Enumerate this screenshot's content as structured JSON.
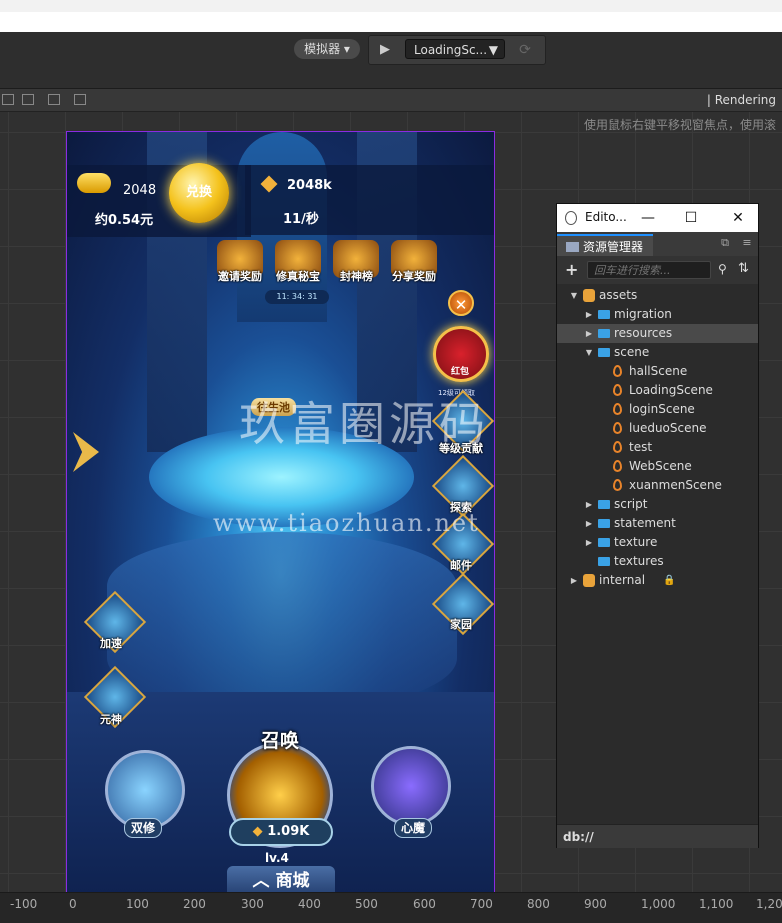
{
  "toolbar": {
    "simulator_label": "模拟器 ▾",
    "play_icon": "play-icon",
    "scene_select_value": "LoadingSc...",
    "refresh_icon": "refresh-icon"
  },
  "scene_view": {
    "rendering_label": "Rendering",
    "hint_text": "使用鼠标右键平移视窗焦点，使用滚",
    "ruler_ticks": [
      "-100",
      "0",
      "100",
      "200",
      "300",
      "400",
      "500",
      "600",
      "700",
      "800",
      "900",
      "1,000",
      "1,100",
      "1,20"
    ]
  },
  "game": {
    "coins": "2048",
    "coins_rmb": "约0.54元",
    "exchange_label": "兑换",
    "income_total": "2048k",
    "income_rate": "11/秒",
    "top_icons": [
      {
        "label": "邀请奖励"
      },
      {
        "label": "修真秘宝"
      },
      {
        "label": "封神榜"
      },
      {
        "label": "分享奖励"
      }
    ],
    "timer": "11: 34: 31",
    "close_symbol": "✕",
    "redpack_label": "红包",
    "redpack_sub": "12级可领取",
    "pool_label": "往生池",
    "right_icons": [
      {
        "label": "等级贡献"
      },
      {
        "label": "探索"
      },
      {
        "label": "邮件"
      },
      {
        "label": "家园"
      }
    ],
    "left_icons": [
      {
        "label": "加速"
      },
      {
        "label": "元神"
      }
    ],
    "summon_title": "召唤",
    "summon_cost": "1.09K",
    "level": "lv.4",
    "shop_label": "商城",
    "dual_label": "双修",
    "demon_label": "心魔",
    "watermark_cn": "玖富圈源码",
    "watermark_url": "www.tiaozhuan.net"
  },
  "editor_window": {
    "title": "Edito...",
    "minimize": "—",
    "maximize": "☐",
    "close": "✕",
    "panel_tab": "资源管理器",
    "search_placeholder": "回车进行搜索...",
    "footer": "db://",
    "tree": [
      {
        "label": "assets",
        "type": "db",
        "depth": 0,
        "expanded": true
      },
      {
        "label": "migration",
        "type": "folder",
        "depth": 1,
        "expanded": false
      },
      {
        "label": "resources",
        "type": "folder",
        "depth": 1,
        "expanded": false,
        "selected": true
      },
      {
        "label": "scene",
        "type": "folder",
        "depth": 1,
        "expanded": true
      },
      {
        "label": "hallScene",
        "type": "scene",
        "depth": 2
      },
      {
        "label": "LoadingScene",
        "type": "scene",
        "depth": 2
      },
      {
        "label": "loginScene",
        "type": "scene",
        "depth": 2
      },
      {
        "label": "lueduoScene",
        "type": "scene",
        "depth": 2
      },
      {
        "label": "test",
        "type": "scene",
        "depth": 2
      },
      {
        "label": "WebScene",
        "type": "scene",
        "depth": 2
      },
      {
        "label": "xuanmenScene",
        "type": "scene",
        "depth": 2
      },
      {
        "label": "script",
        "type": "folder",
        "depth": 1,
        "expanded": false
      },
      {
        "label": "statement",
        "type": "folder",
        "depth": 1,
        "expanded": false
      },
      {
        "label": "texture",
        "type": "folder",
        "depth": 1,
        "expanded": false
      },
      {
        "label": "textures",
        "type": "folder",
        "depth": 1,
        "leaf": true
      },
      {
        "label": "internal",
        "type": "db",
        "depth": 0,
        "expanded": false,
        "locked": true
      }
    ]
  }
}
